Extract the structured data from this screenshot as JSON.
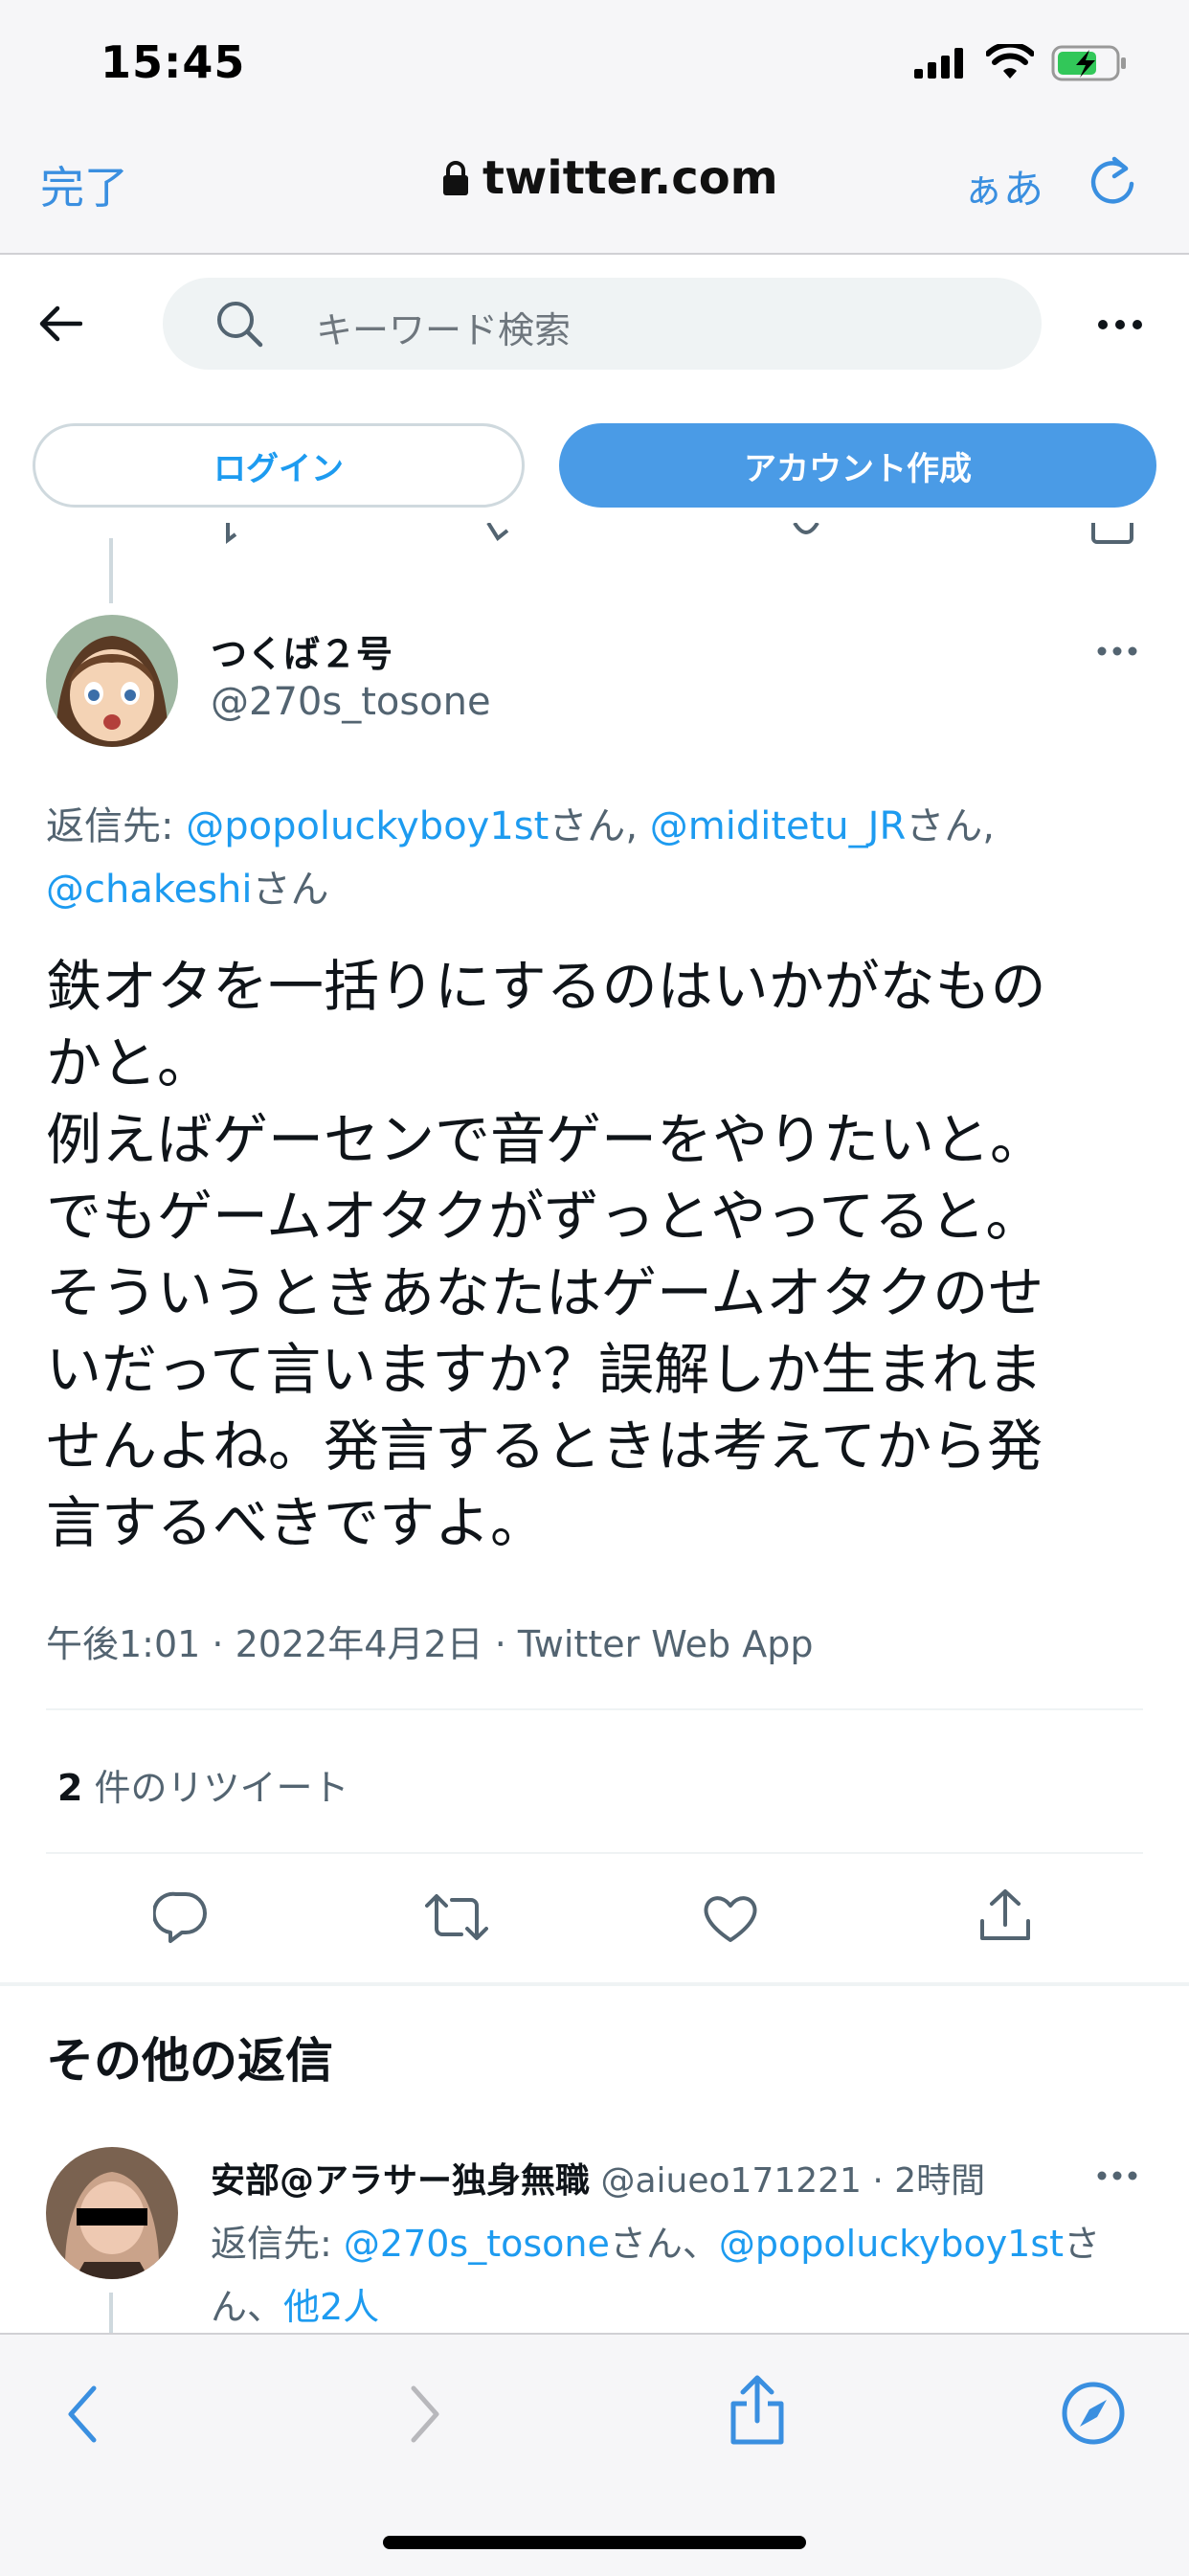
{
  "status_bar": {
    "time": "15:45"
  },
  "browser": {
    "done_label": "完了",
    "url": "twitter.com",
    "text_size_label": "ぁあ"
  },
  "header": {
    "search_placeholder": "キーワード検索",
    "login_label": "ログイン",
    "signup_label": "アカウント作成"
  },
  "tweet": {
    "display_name": "つくば２号",
    "handle": "@270s_tosone",
    "reply_prefix": "返信先: ",
    "reply_to": [
      "@popoluckyboy1st",
      "@miditetu_JR",
      "@chakeshi"
    ],
    "reply_suffix": "さん",
    "body": "鉄オタを一括りにするのはいかがなもの\nかと。\n例えばゲーセンで音ゲーをやりたいと。\nでもゲームオタクがずっとやってると。\nそういうときあなたはゲームオタクのせ\nいだって言いますか？誤解しか生まれま\nせんよね。発言するときは考えてから発\n言するべきですよ。",
    "timestamp": "午後1:01 · 2022年4月2日 · Twitter Web App",
    "retweet_count": "2",
    "retweet_label": " 件のリツイート"
  },
  "more_replies": {
    "title": "その他の返信",
    "reply": {
      "display_name": "安部@アラサー独身無職",
      "handle_time": " @aiueo171221 · 2時間",
      "reply_prefix": "返信先: ",
      "reply_to_1": "@270s_tosone",
      "reply_mid": "さん、",
      "reply_to_2": "@popoluckyboy1st",
      "reply_suffix_1": "さ",
      "reply_suffix_2": "ん、",
      "others": "他2人"
    }
  },
  "colors": {
    "link": "#1d9bf0",
    "signup_bg": "#4a9be6",
    "safari_blue": "#3a8fe0"
  }
}
